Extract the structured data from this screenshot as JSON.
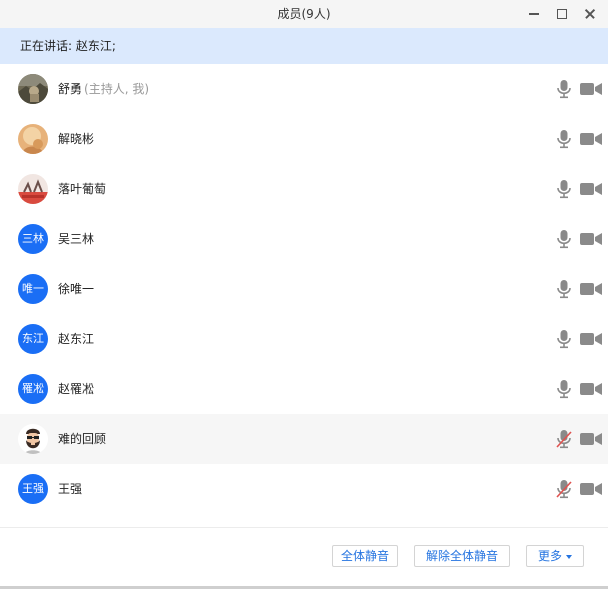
{
  "window": {
    "title": "成员(9人)"
  },
  "speaking": {
    "text": "正在讲话: 赵东江;"
  },
  "members": [
    {
      "name": "舒勇",
      "tag": "(主持人, 我)",
      "avatar": "photo-landscape",
      "muted": false,
      "highlight": false
    },
    {
      "name": "解晓彬",
      "tag": "",
      "avatar": "photo-warm",
      "muted": false,
      "highlight": false
    },
    {
      "name": "落叶葡萄",
      "tag": "",
      "avatar": "photo-red",
      "muted": false,
      "highlight": false
    },
    {
      "name": "吴三林",
      "tag": "",
      "avatar_text": "三林",
      "muted": false,
      "highlight": false
    },
    {
      "name": "徐唯一",
      "tag": "",
      "avatar_text": "唯一",
      "muted": false,
      "highlight": false
    },
    {
      "name": "赵东江",
      "tag": "",
      "avatar_text": "东江",
      "muted": false,
      "highlight": false
    },
    {
      "name": "赵罹凇",
      "tag": "",
      "avatar_text": "罹凇",
      "muted": false,
      "highlight": false
    },
    {
      "name": "难的回顾",
      "tag": "",
      "avatar": "cartoon-beard",
      "muted": true,
      "highlight": true
    },
    {
      "name": "王强",
      "tag": "",
      "avatar_text": "王强",
      "muted": true,
      "highlight": false
    }
  ],
  "footer": {
    "mute_all": "全体静音",
    "unmute_all": "解除全体静音",
    "more": "更多"
  },
  "colors": {
    "accent": "#1a6ef5",
    "speaking_bar": "#dbe9fd",
    "muted_slash": "#e0524f",
    "icon_gray": "#8a8a8a"
  }
}
